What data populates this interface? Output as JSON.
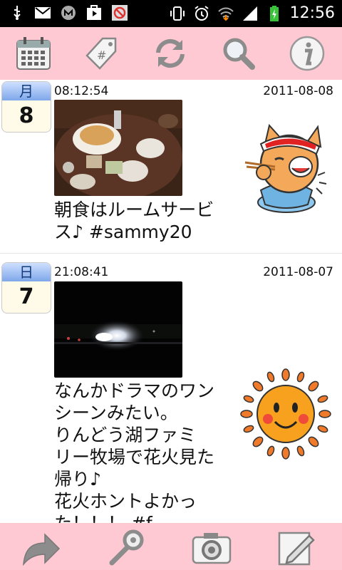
{
  "status_bar": {
    "time": "12:56",
    "icons": [
      "usb-icon",
      "gmail-icon",
      "app-icon",
      "play-store-icon",
      "blocked-app-icon",
      "vibrate-icon",
      "alarm-icon",
      "wifi-icon",
      "signal-icon",
      "battery-charging-icon"
    ]
  },
  "toolbar": {
    "buttons": [
      "calendar-icon",
      "tag-icon",
      "refresh-icon",
      "search-icon",
      "info-icon"
    ],
    "tag_symbol": "#"
  },
  "posts": [
    {
      "day_of_week": "月",
      "day": "8",
      "time": "08:12:54",
      "date": "2011-08-08",
      "photo": "breakfast-photo",
      "text_lines": [
        "朝食はルームサービ",
        "ス♪ #sammy20"
      ],
      "sticker": "cat-eating-sticker"
    },
    {
      "day_of_week": "日",
      "day": "7",
      "time": "21:08:41",
      "date": "2011-08-07",
      "photo": "night-fireworks-photo",
      "text_lines": [
        "なんかドラマのワン",
        "シーンみたい。",
        "りんどう湖ファミ",
        "リー牧場で花火見た",
        "帰り♪",
        "花火ホントよかっ",
        "た！！！ #f..."
      ],
      "sticker": "sun-face-sticker"
    }
  ],
  "bottom_bar": {
    "buttons": [
      "share-arrow-icon",
      "settings-wrench-icon",
      "camera-icon",
      "compose-icon"
    ]
  },
  "colors": {
    "toolbar_bg": "#ffc9d3",
    "status_bg": "#000000",
    "badge_top": "#7ea7ea",
    "badge_bg": "#fffbe8"
  }
}
